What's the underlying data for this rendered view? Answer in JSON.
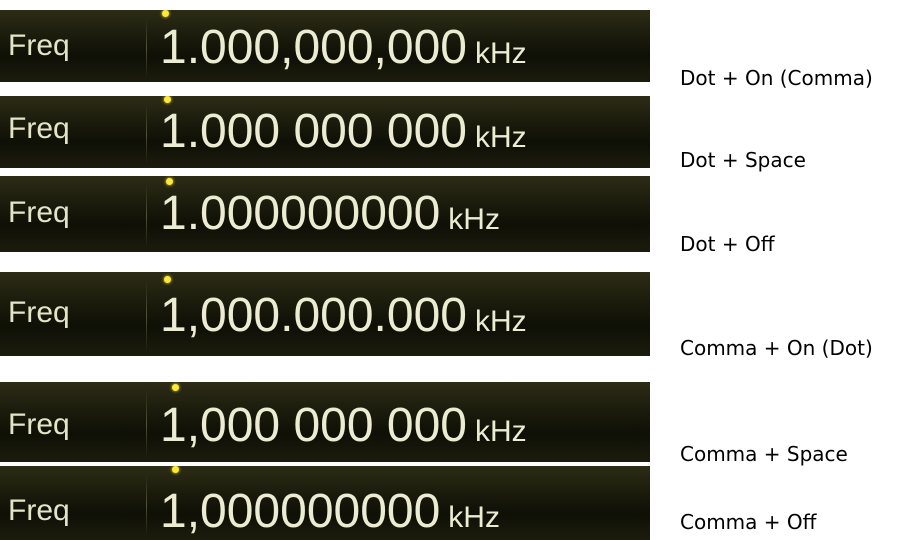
{
  "rows": [
    {
      "label": "Freq",
      "value": "1.000,000,000",
      "unit": "kHz",
      "caption": "Dot + On (Comma)"
    },
    {
      "label": "Freq",
      "value": "1.000 000 000",
      "unit": "kHz",
      "caption": "Dot + Space"
    },
    {
      "label": "Freq",
      "value": "1.000000000",
      "unit": "kHz",
      "caption": "Dot + Off"
    },
    {
      "label": "Freq",
      "value": "1,000.000.000",
      "unit": "kHz",
      "caption": "Comma + On (Dot)"
    },
    {
      "label": "Freq",
      "value": "1,000 000 000",
      "unit": "kHz",
      "caption": "Comma + Space"
    },
    {
      "label": "Freq",
      "value": "1,000000000",
      "unit": "kHz",
      "caption": "Comma + Off"
    }
  ],
  "colors": {
    "panel_background": "#191a0b",
    "display_text": "#ececd2",
    "cursor_dot": "#ffe83a",
    "caption_text": "#000000"
  }
}
